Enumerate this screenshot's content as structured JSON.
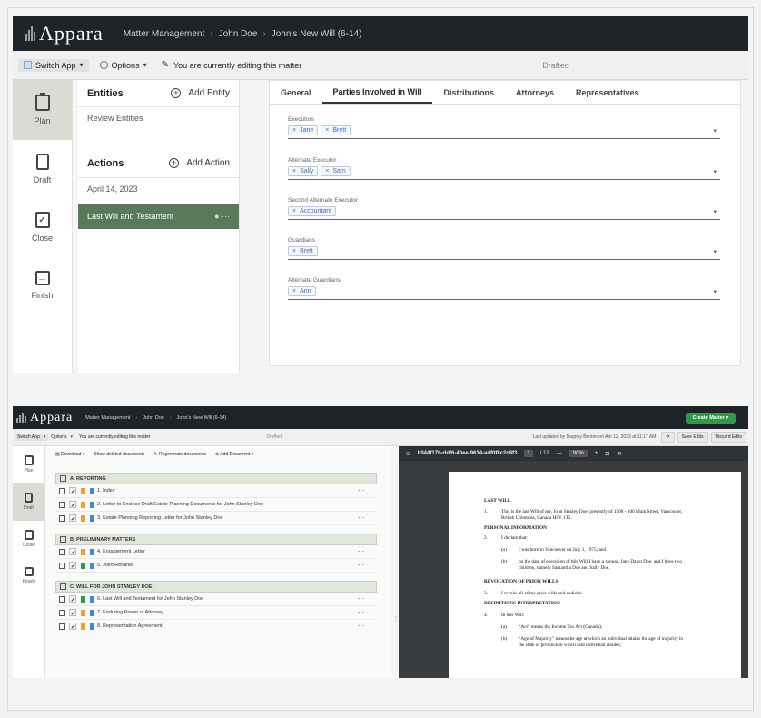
{
  "app": {
    "logo": "Appara"
  },
  "top": {
    "breadcrumbs": [
      "Matter Management",
      "John Doe",
      "John's New Will (6-14)"
    ],
    "switch_app": "Switch App",
    "options": "Options",
    "editing": "You are currently editing this matter",
    "status": "Drafted"
  },
  "nav": [
    {
      "label": "Plan",
      "icon": "clipboard-icon"
    },
    {
      "label": "Draft",
      "icon": "document-edit-icon"
    },
    {
      "label": "Close",
      "icon": "clipboard-check-icon"
    },
    {
      "label": "Finish",
      "icon": "exit-arrow-icon"
    }
  ],
  "plan": {
    "entities_title": "Entities",
    "add_entity": "Add Entity",
    "review_entities": "Review Entities",
    "actions_title": "Actions",
    "add_action": "Add Action",
    "date": "April 14, 2023",
    "selected_action": "Last Will and Testament",
    "selected_dots": "● ⋯"
  },
  "tabs": [
    "General",
    "Parties Involved in Will",
    "Distributions",
    "Attorneys",
    "Representatives"
  ],
  "fields": [
    {
      "label": "Executors",
      "chips": [
        "Jane",
        "Brett"
      ]
    },
    {
      "label": "Alternate Executor",
      "chips": [
        "Sally",
        "Sam"
      ]
    },
    {
      "label": "Second Alternate Executor",
      "chips": [
        "Accountant"
      ]
    },
    {
      "label": "Guardians",
      "chips": [
        "Brett"
      ]
    },
    {
      "label": "Alternate Guardians",
      "chips": [
        "Ann"
      ]
    }
  ],
  "draft": {
    "create_matter": "Create Matter",
    "last_updated": "Last updated by Dagney Benton on Apr 12, 2023 at 11:17 AM",
    "save_edits": "Save Edits",
    "discard_edits": "Discard Edits",
    "download": "Download",
    "show_deleted": "Show deleted documents",
    "regenerate": "Regenerate documents",
    "add_document": "Add Document",
    "groups": [
      {
        "title": "A. REPORTING",
        "docs": [
          {
            "name": "1. Index",
            "flag": "#f0a030"
          },
          {
            "name": "2. Letter to Enclose Draft Estate Planning Documents for John Stanley Doe",
            "flag": "#f0a030"
          },
          {
            "name": "3. Estate Planning Reporting Letter for John Stanley Doe",
            "flag": "#f0a030"
          }
        ]
      },
      {
        "title": "B. PRELIMINARY MATTERS",
        "docs": [
          {
            "name": "4. Engagement Letter",
            "flag": "#f0a030"
          },
          {
            "name": "5. Joint Retainer",
            "flag": "#2e9a4a"
          }
        ]
      },
      {
        "title": "C. WILL FOR JOHN STANLEY DOE",
        "docs": [
          {
            "name": "6. Last Will and Testament for John Stanley Doe",
            "flag": "#2e9a4a"
          },
          {
            "name": "7. Enduring Power of Attorney",
            "flag": "#f0a030"
          },
          {
            "name": "8. Representation Agreement",
            "flag": "#f0a030"
          }
        ]
      }
    ],
    "pdf": {
      "file": "b044f17b-ddf6-40ee-9634-adf0f8c2c8f3",
      "page": "1",
      "pages": "/ 12",
      "zoom": "90%",
      "lines": [
        "LAST WILL",
        "1.",
        "This is the last Will of me, John Stanley Doe, presently of 1500 - 100 Main Street, Vancouver,",
        "British Columbia, Canada H8Y 1T5.",
        "PERSONAL INFORMATION",
        "2.",
        "I declare that:",
        "(a)",
        "I was born in Vancouver on July 1, 1975; and",
        "(b)",
        "on the date of execution of this Will I have a spouse, Jane Dawn Doe, and I have two",
        "children, namely Samantha Doe and Sally Doe.",
        "REVOCATION OF PRIOR WILLS",
        "3.",
        "I revoke all of my prior wills and codicils.",
        "DEFINITIONS INTERPRETATION",
        "4.",
        "In this Will:",
        "(a)",
        "“Act” means the Income Tax Act (Canada);",
        "(b)",
        "“Age of Majority” means the age at which an individual attains the age of majority in",
        "the state or province in which said individual resides;"
      ]
    }
  }
}
